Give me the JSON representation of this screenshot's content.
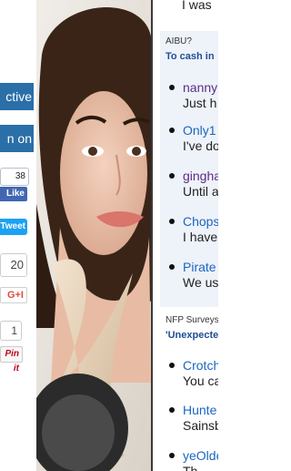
{
  "share": {
    "tab1_label": "ctive",
    "tab2_label": "n on",
    "facebook_count": "38",
    "facebook_like": "Like",
    "tweet_label": "Tweet",
    "gplus_count": "20",
    "gplus_label": "G+I",
    "pin_count": "1",
    "pin_label": "Pin it"
  },
  "ad": {
    "description": "advertisement image"
  },
  "right": {
    "previous_text": "I was",
    "sections": [
      {
        "label": "AIBU?",
        "title": "To cash in",
        "items": [
          {
            "link": "nanny",
            "link_color": "#5b2d86",
            "text": "Just h"
          },
          {
            "link": "Only1",
            "link_color": "#1a66c2",
            "text": "I've do"
          },
          {
            "link": "gingha",
            "link_color": "#5b2d86",
            "text": "Until a"
          },
          {
            "link": "Chops",
            "link_color": "#1a66c2",
            "text": "I have"
          },
          {
            "link": "Pirate",
            "link_color": "#1a66c2",
            "text": "We us"
          }
        ]
      },
      {
        "label": "NFP Surveys",
        "title": "'Unexpecte",
        "items": [
          {
            "link": "Crotch",
            "link_color": "#1a66c2",
            "text": "You ca"
          },
          {
            "link": "Hunte",
            "link_color": "#1a66c2",
            "text": "Sainsb"
          },
          {
            "link": "yeOlde",
            "link_color": "#1a66c2",
            "text": "Th"
          }
        ]
      }
    ]
  }
}
